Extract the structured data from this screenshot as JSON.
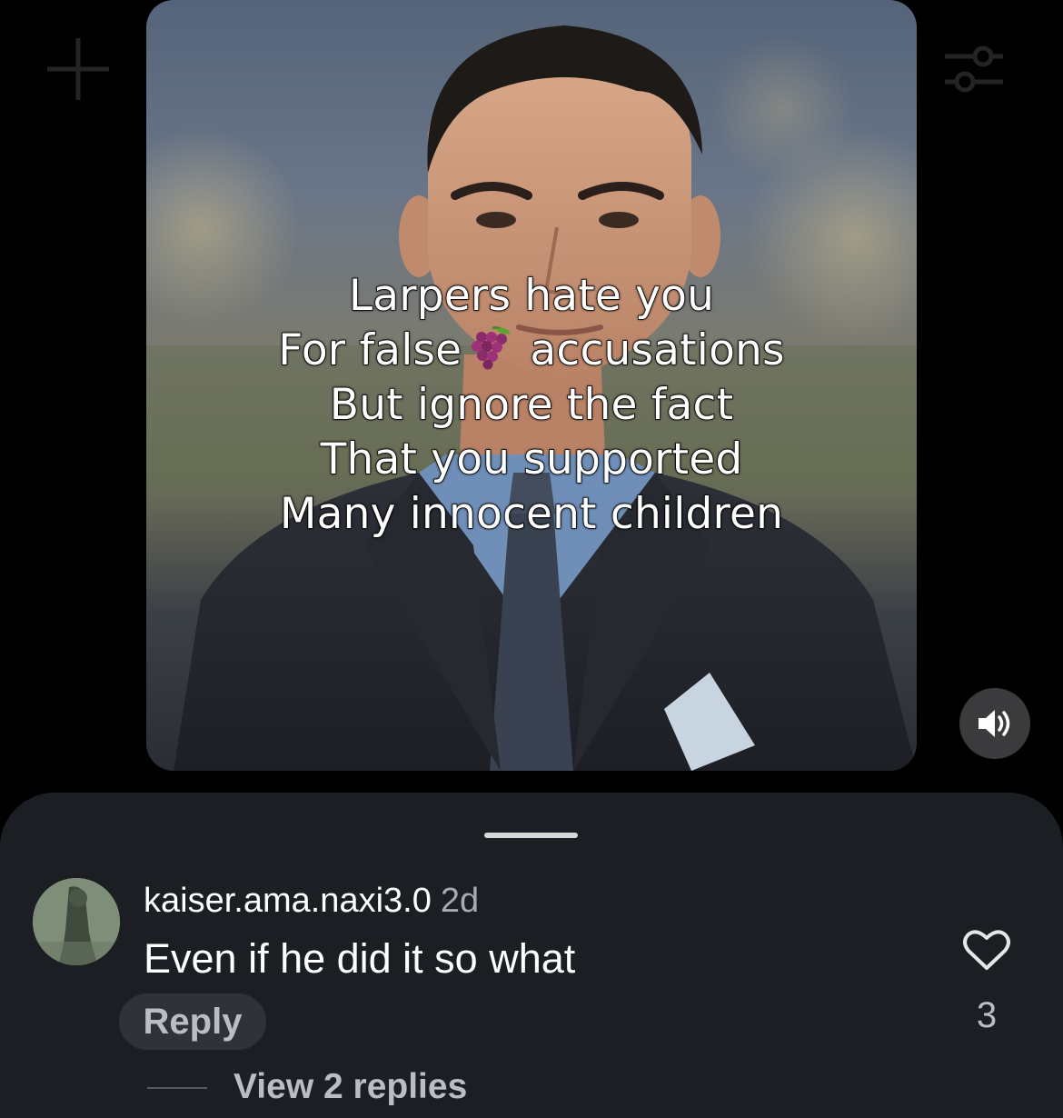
{
  "video": {
    "caption_lines": [
      "Larpers hate you",
      "For false",
      "accusations",
      "But ignore the fact",
      "That you supported",
      "Many innocent children"
    ],
    "caption_emoji": "🍇",
    "sound_icon": "speaker-on-icon"
  },
  "background_icons": [
    "plus-icon",
    "filter-icon"
  ],
  "comment": {
    "author": "kaiser.ama.naxi3.0",
    "time": "2d",
    "text": "Even if he did it so what",
    "reply_label": "Reply",
    "like_icon": "heart-icon",
    "like_count": "3",
    "view_replies_label": "View 2 replies"
  },
  "colors": {
    "sheet_background": "#1b1f24",
    "reply_pill": "#2f3338",
    "muted_text": "#b9bec4"
  }
}
